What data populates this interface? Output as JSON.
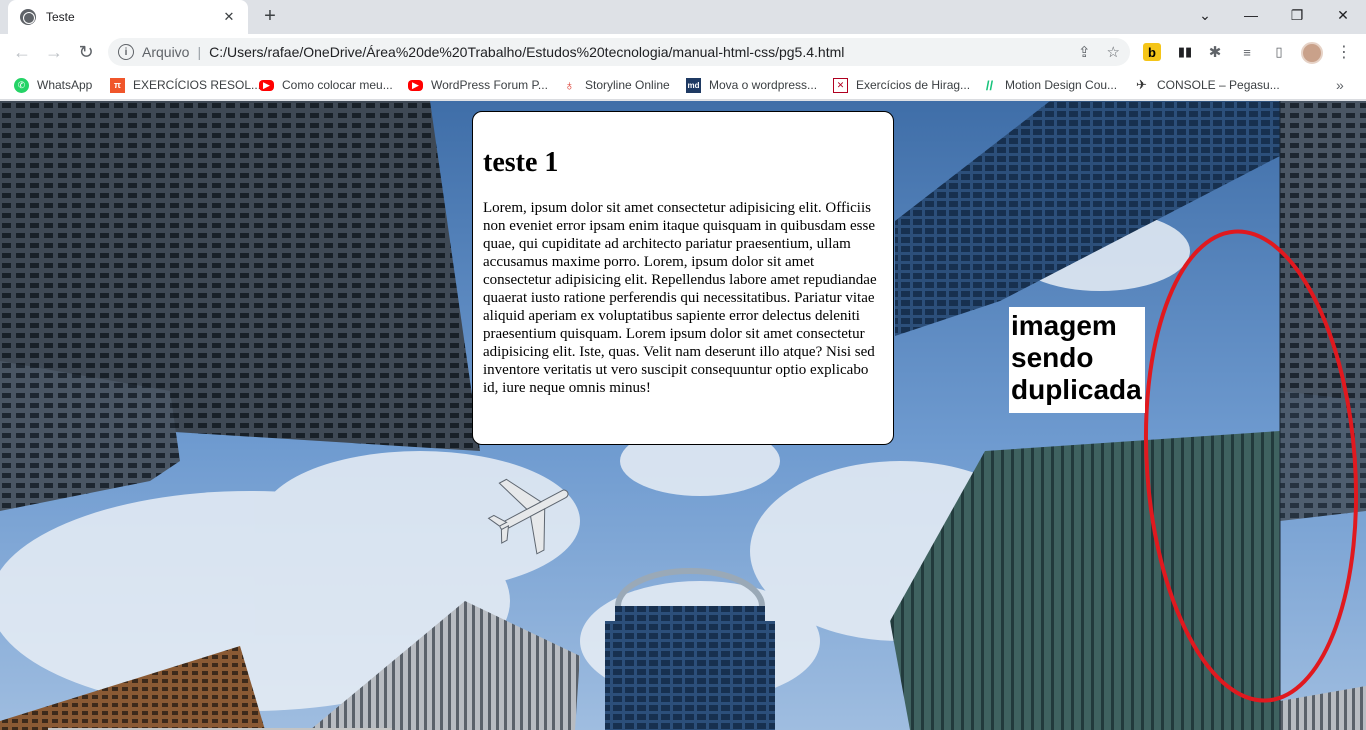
{
  "tab": {
    "title": "Teste",
    "close": "✕"
  },
  "new_tab": "+",
  "window_controls": {
    "minimize": "—",
    "restore": "❐",
    "close": "✕",
    "list": "⌄"
  },
  "toolbar": {
    "back": "←",
    "forward": "→",
    "reload": "↻",
    "info_icon": "i",
    "scheme_label": "Arquivo",
    "url": "C:/Users/rafae/OneDrive/Área%20de%20Trabalho/Estudos%20tecnologia/manual-html-css/pg5.4.html",
    "share_icon": "⇪",
    "star_icon": "☆"
  },
  "extensions": {
    "b_label": "b",
    "dark_label": "▮▮",
    "puzzle": "✱",
    "media": "≡",
    "sidepanel": "▯",
    "menu": "⋮"
  },
  "bookmarks": [
    {
      "label": "WhatsApp",
      "icon": "whatsapp-icon",
      "color": "#25d366"
    },
    {
      "label": "EXERCÍCIOS RESOL...",
      "icon": "pi-icon",
      "color": "#f0562b"
    },
    {
      "label": "Como colocar meu...",
      "icon": "youtube-icon",
      "color": "#ff0000"
    },
    {
      "label": "WordPress Forum P...",
      "icon": "youtube-icon",
      "color": "#ff0000"
    },
    {
      "label": "Storyline Online",
      "icon": "storyline-icon",
      "color": "#d93025"
    },
    {
      "label": "Mova o wordpress...",
      "icon": "md-icon",
      "color": "#1f3a63"
    },
    {
      "label": "Exercícios de Hirag...",
      "icon": "hiragana-icon",
      "color": "#b00020"
    },
    {
      "label": "Motion Design Cou...",
      "icon": "motion-icon",
      "color": "#17c37b"
    },
    {
      "label": "CONSOLE – Pegasu...",
      "icon": "pegasus-icon",
      "color": "#333333"
    }
  ],
  "bookmarks_more": "»",
  "content": {
    "heading": "teste 1",
    "paragraph": "Lorem, ipsum dolor sit amet consectetur adipisicing elit. Officiis non eveniet error ipsam enim itaque quisquam in quibusdam esse quae, qui cupiditate ad architecto pariatur praesentium, ullam accusamus maxime porro. Lorem, ipsum dolor sit amet consectetur adipisicing elit. Repellendus labore amet repudiandae quaerat iusto ratione perferendis qui necessitatibus. Pariatur vitae aliquid aperiam ex voluptatibus sapiente error delectus deleniti praesentium quisquam. Lorem ipsum dolor sit amet consectetur adipisicing elit. Iste, quas. Velit nam deserunt illo atque? Nisi sed inventore veritatis ut vero suscipit consequuntur optio explicabo id, iure neque omnis minus!",
    "annotation": "imagem sendo duplicada"
  },
  "colors": {
    "sky": "#4f86c9",
    "annotation_circle": "#e0191f"
  }
}
